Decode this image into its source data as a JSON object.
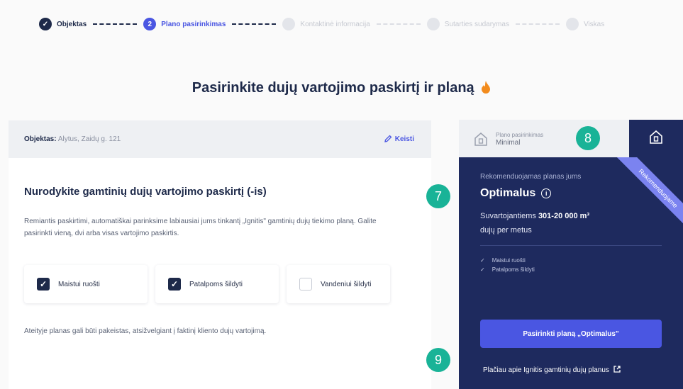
{
  "stepper": {
    "steps": [
      {
        "label": "Objektas",
        "state": "done",
        "marker": "✓"
      },
      {
        "label": "Plano pasirinkimas",
        "state": "active",
        "marker": "2"
      },
      {
        "label": "Kontaktinė informacija",
        "state": "future",
        "marker": ""
      },
      {
        "label": "Sutarties sudarymas",
        "state": "future",
        "marker": ""
      },
      {
        "label": "Viskas",
        "state": "future",
        "marker": ""
      }
    ]
  },
  "page_title": "Pasirinkite dujų vartojimo paskirtį ir planą",
  "object_bar": {
    "label": "Objektas:",
    "value": "Alytus, Zaidų g. 121",
    "change_label": "Keisti"
  },
  "section": {
    "title": "Nurodykite gamtinių dujų vartojimo paskirtį (-is)",
    "description": "Remiantis paskirtimi, automatiškai parinksime labiausiai jums tinkantį „Ignitis\" gamtinių dujų tiekimo planą. Galite pasirinkti vieną, dvi arba visas vartojimo paskirtis.",
    "options": [
      {
        "label": "Maistui ruošti",
        "checked": true
      },
      {
        "label": "Patalpoms šildyti",
        "checked": true
      },
      {
        "label": "Vandeniui šildyti",
        "checked": false
      }
    ],
    "footer_note": "Ateityje planas gali būti pakeistas, atsižvelgiant į faktinį kliento dujų vartojimą."
  },
  "plan_tab": {
    "label": "Plano pasirinkimas",
    "value": "Minimal"
  },
  "plan_card": {
    "ribbon": "Rekomenduojame",
    "rec_label": "Rekomenduojamas planas jums",
    "plan_name": "Optimalus",
    "usage_prefix": "Suvartojantiems",
    "usage_value": "301-20 000 m³",
    "usage_suffix": "dujų per metus",
    "features": [
      "Maistui ruošti",
      "Patalpoms šildyti"
    ],
    "choose_button": "Pasirinkti planą „Optimalus\"",
    "more_link": "Plačiau apie Ignitis gamtinių dujų planus"
  },
  "markers": [
    "7",
    "8",
    "9"
  ],
  "colors": {
    "navy": "#1e2a5e",
    "accent": "#4a56e2",
    "marker": "#19b397",
    "flame": "#f28b1d"
  }
}
